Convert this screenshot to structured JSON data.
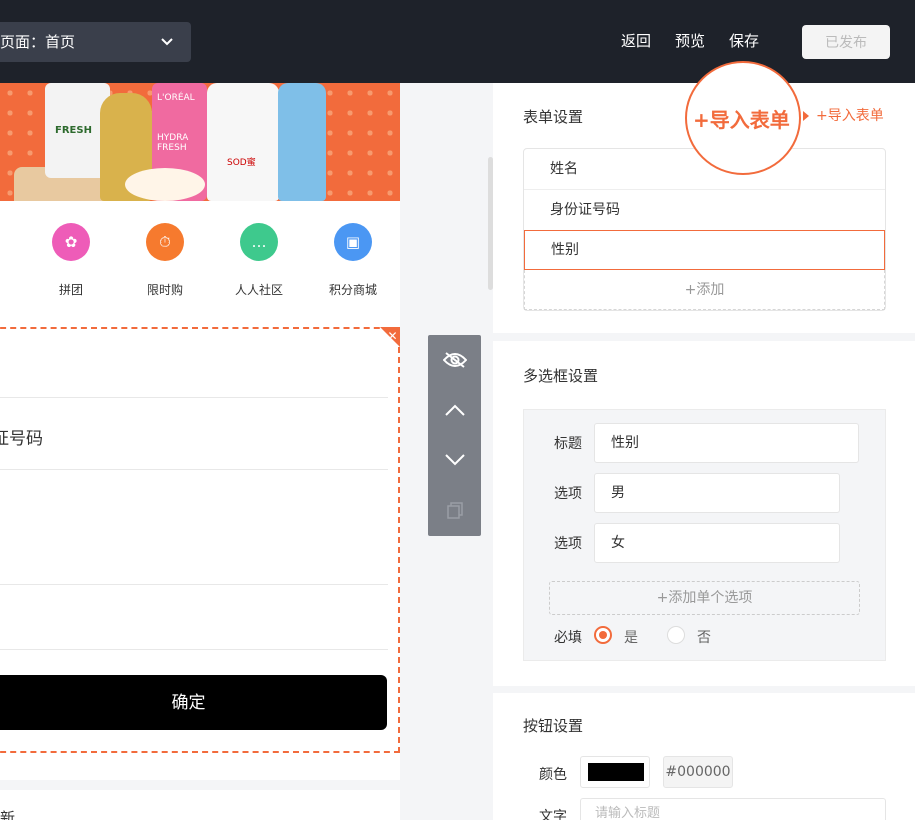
{
  "header": {
    "page_select": "页面：首页",
    "nav": [
      "返回",
      "预览",
      "保存"
    ],
    "publish": "已发布"
  },
  "preview": {
    "banner_labels": [
      "FRESH",
      "HYDRA FRESH",
      "L'ORÉAL",
      "SOD蜜"
    ],
    "icons": [
      {
        "label": "拼团",
        "color": "#ee5cb8",
        "icon": "group-buy-icon"
      },
      {
        "label": "限时购",
        "color": "#f67a2e",
        "icon": "timer-icon"
      },
      {
        "label": "人人社区",
        "color": "#3ec98d",
        "icon": "chat-icon"
      },
      {
        "label": "积分商城",
        "color": "#4b97f3",
        "icon": "bag-icon"
      }
    ],
    "form_text": "证号码",
    "confirm": "确定",
    "bottom_text": "新"
  },
  "toolbar": [
    "eye-icon",
    "up-icon",
    "down-icon",
    "copy-icon"
  ],
  "form_settings": {
    "title": "表单设置",
    "import_link": "+导入表单",
    "callout": "+导入表单",
    "fields": [
      "姓名",
      "身份证号码",
      "性别"
    ],
    "add": "+添加"
  },
  "multi_select": {
    "title": "多选框设置",
    "title_label": "标题",
    "title_value": "性别",
    "option_label": "选项",
    "options": [
      "男",
      "女"
    ],
    "add_option": "+添加单个选项",
    "required_label": "必填",
    "yes": "是",
    "no": "否"
  },
  "button_settings": {
    "title": "按钮设置",
    "color_label": "颜色",
    "color_value": "#000000",
    "text_label": "文字",
    "text_placeholder": "请输入标题"
  },
  "colors": {
    "accent": "#f26b3c",
    "header": "#1e222a"
  }
}
